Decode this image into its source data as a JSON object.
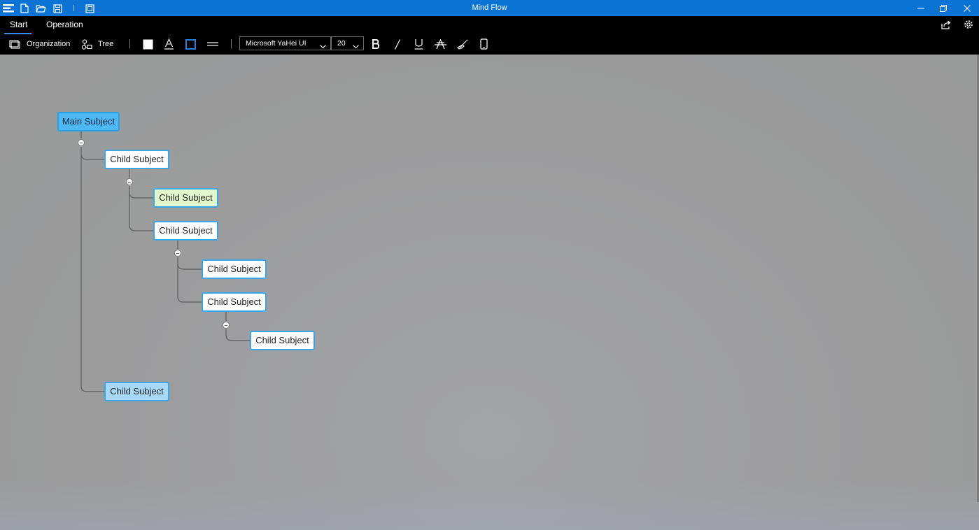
{
  "window": {
    "title": "Mind Flow",
    "quick_icons": [
      "menu-icon",
      "new-file-icon",
      "open-folder-icon",
      "save-icon",
      "save-as-icon"
    ],
    "controls": [
      "minimize-icon",
      "restore-icon",
      "close-icon"
    ]
  },
  "ribbon": {
    "tabs": [
      {
        "label": "Start",
        "active": true
      },
      {
        "label": "Operation",
        "active": false
      }
    ],
    "layout_tools": [
      {
        "label": "Organization",
        "icon": "organization-icon"
      },
      {
        "label": "Tree",
        "icon": "tree-icon"
      }
    ],
    "format_tools": [
      "fill-color-icon",
      "font-color-icon",
      "border-color-icon",
      "line-style-icon"
    ],
    "font_family": "Microsoft YaHei UI",
    "font_size": "20",
    "text_style_tools": [
      "bold-icon",
      "italic-icon",
      "underline-icon",
      "strikethrough-icon",
      "clear-format-icon",
      "device-icon"
    ],
    "right_icons": [
      "share-icon",
      "settings-icon"
    ],
    "colors": {
      "accent": "#0a73d4",
      "tab_underline": "#2f8bf0"
    }
  },
  "mindmap": {
    "main": {
      "label": "Main Subject"
    },
    "children": [
      {
        "label": "Child Subject"
      },
      {
        "label": "Child Subject"
      },
      {
        "label": "Child Subject"
      },
      {
        "label": "Child Subject"
      },
      {
        "label": "Child Subject"
      },
      {
        "label": "Child Subject"
      },
      {
        "label": "Child Subject"
      }
    ],
    "colors": {
      "node_border": "#3aa6e8",
      "main_fill": "#4db8f4",
      "highlight_green": "#e2f7cc",
      "highlight_blue": "#a8d9f8"
    }
  }
}
